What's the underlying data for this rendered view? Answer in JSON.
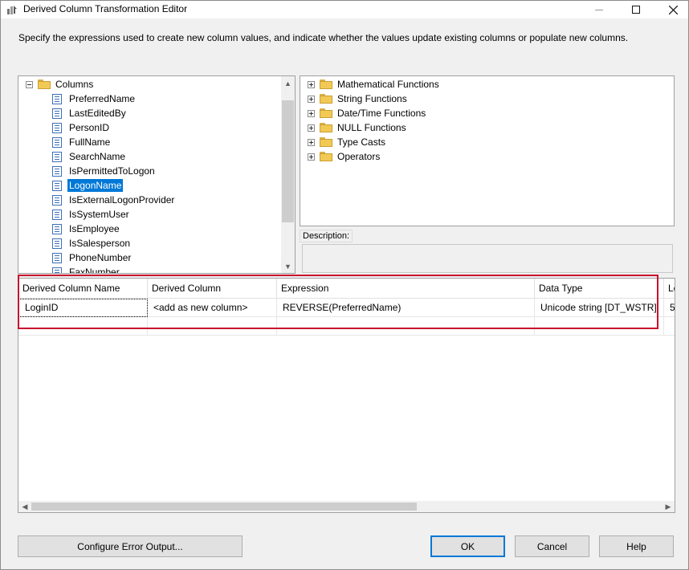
{
  "window": {
    "title": "Derived Column Transformation Editor",
    "icon": "transform-icon"
  },
  "instructions": "Specify the expressions used to create new column values, and indicate whether the values update existing columns or populate new columns.",
  "columns_tree": {
    "root_label": "Columns",
    "items": [
      {
        "label": "PreferredName",
        "selected": false
      },
      {
        "label": "LastEditedBy",
        "selected": false
      },
      {
        "label": "PersonID",
        "selected": false
      },
      {
        "label": "FullName",
        "selected": false
      },
      {
        "label": "SearchName",
        "selected": false
      },
      {
        "label": "IsPermittedToLogon",
        "selected": false
      },
      {
        "label": "LogonName",
        "selected": true
      },
      {
        "label": "IsExternalLogonProvider",
        "selected": false
      },
      {
        "label": "IsSystemUser",
        "selected": false
      },
      {
        "label": "IsEmployee",
        "selected": false
      },
      {
        "label": "IsSalesperson",
        "selected": false
      },
      {
        "label": "PhoneNumber",
        "selected": false
      },
      {
        "label": "FaxNumber",
        "selected": false
      }
    ]
  },
  "functions_tree": {
    "items": [
      {
        "label": "Mathematical Functions"
      },
      {
        "label": "String Functions"
      },
      {
        "label": "Date/Time Functions"
      },
      {
        "label": "NULL Functions"
      },
      {
        "label": "Type Casts"
      },
      {
        "label": "Operators"
      }
    ]
  },
  "description": {
    "label": "Description:",
    "text": ""
  },
  "grid": {
    "headers": [
      "Derived Column Name",
      "Derived Column",
      "Expression",
      "Data Type",
      "Le"
    ],
    "rows": [
      [
        "LoginID",
        "<add as new column>",
        "REVERSE(PreferredName)",
        "Unicode string [DT_WSTR]",
        "5"
      ]
    ]
  },
  "buttons": {
    "configure": "Configure Error Output...",
    "ok": "OK",
    "cancel": "Cancel",
    "help": "Help"
  },
  "colors": {
    "selection": "#0078d7",
    "highlight_border": "#c8102e"
  }
}
